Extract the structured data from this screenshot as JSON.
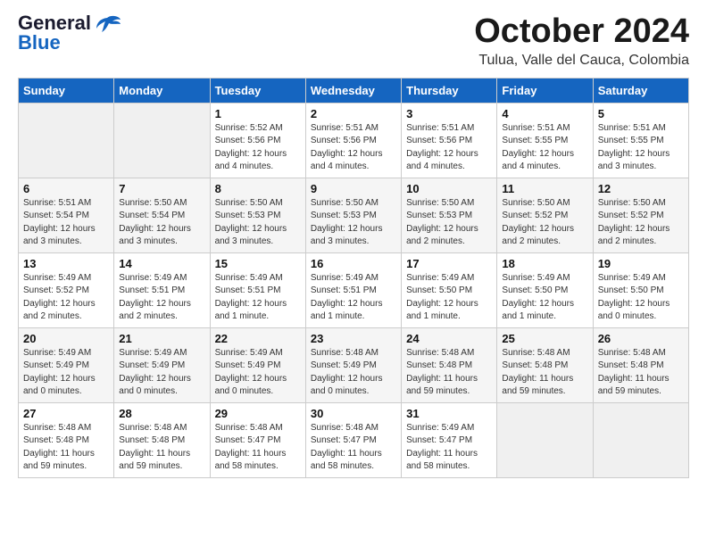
{
  "header": {
    "logo_line1": "General",
    "logo_line2": "Blue",
    "month": "October 2024",
    "location": "Tulua, Valle del Cauca, Colombia"
  },
  "weekdays": [
    "Sunday",
    "Monday",
    "Tuesday",
    "Wednesday",
    "Thursday",
    "Friday",
    "Saturday"
  ],
  "weeks": [
    [
      {
        "day": "",
        "info": ""
      },
      {
        "day": "",
        "info": ""
      },
      {
        "day": "1",
        "info": "Sunrise: 5:52 AM\nSunset: 5:56 PM\nDaylight: 12 hours\nand 4 minutes."
      },
      {
        "day": "2",
        "info": "Sunrise: 5:51 AM\nSunset: 5:56 PM\nDaylight: 12 hours\nand 4 minutes."
      },
      {
        "day": "3",
        "info": "Sunrise: 5:51 AM\nSunset: 5:56 PM\nDaylight: 12 hours\nand 4 minutes."
      },
      {
        "day": "4",
        "info": "Sunrise: 5:51 AM\nSunset: 5:55 PM\nDaylight: 12 hours\nand 4 minutes."
      },
      {
        "day": "5",
        "info": "Sunrise: 5:51 AM\nSunset: 5:55 PM\nDaylight: 12 hours\nand 3 minutes."
      }
    ],
    [
      {
        "day": "6",
        "info": "Sunrise: 5:51 AM\nSunset: 5:54 PM\nDaylight: 12 hours\nand 3 minutes."
      },
      {
        "day": "7",
        "info": "Sunrise: 5:50 AM\nSunset: 5:54 PM\nDaylight: 12 hours\nand 3 minutes."
      },
      {
        "day": "8",
        "info": "Sunrise: 5:50 AM\nSunset: 5:53 PM\nDaylight: 12 hours\nand 3 minutes."
      },
      {
        "day": "9",
        "info": "Sunrise: 5:50 AM\nSunset: 5:53 PM\nDaylight: 12 hours\nand 3 minutes."
      },
      {
        "day": "10",
        "info": "Sunrise: 5:50 AM\nSunset: 5:53 PM\nDaylight: 12 hours\nand 2 minutes."
      },
      {
        "day": "11",
        "info": "Sunrise: 5:50 AM\nSunset: 5:52 PM\nDaylight: 12 hours\nand 2 minutes."
      },
      {
        "day": "12",
        "info": "Sunrise: 5:50 AM\nSunset: 5:52 PM\nDaylight: 12 hours\nand 2 minutes."
      }
    ],
    [
      {
        "day": "13",
        "info": "Sunrise: 5:49 AM\nSunset: 5:52 PM\nDaylight: 12 hours\nand 2 minutes."
      },
      {
        "day": "14",
        "info": "Sunrise: 5:49 AM\nSunset: 5:51 PM\nDaylight: 12 hours\nand 2 minutes."
      },
      {
        "day": "15",
        "info": "Sunrise: 5:49 AM\nSunset: 5:51 PM\nDaylight: 12 hours\nand 1 minute."
      },
      {
        "day": "16",
        "info": "Sunrise: 5:49 AM\nSunset: 5:51 PM\nDaylight: 12 hours\nand 1 minute."
      },
      {
        "day": "17",
        "info": "Sunrise: 5:49 AM\nSunset: 5:50 PM\nDaylight: 12 hours\nand 1 minute."
      },
      {
        "day": "18",
        "info": "Sunrise: 5:49 AM\nSunset: 5:50 PM\nDaylight: 12 hours\nand 1 minute."
      },
      {
        "day": "19",
        "info": "Sunrise: 5:49 AM\nSunset: 5:50 PM\nDaylight: 12 hours\nand 0 minutes."
      }
    ],
    [
      {
        "day": "20",
        "info": "Sunrise: 5:49 AM\nSunset: 5:49 PM\nDaylight: 12 hours\nand 0 minutes."
      },
      {
        "day": "21",
        "info": "Sunrise: 5:49 AM\nSunset: 5:49 PM\nDaylight: 12 hours\nand 0 minutes."
      },
      {
        "day": "22",
        "info": "Sunrise: 5:49 AM\nSunset: 5:49 PM\nDaylight: 12 hours\nand 0 minutes."
      },
      {
        "day": "23",
        "info": "Sunrise: 5:48 AM\nSunset: 5:49 PM\nDaylight: 12 hours\nand 0 minutes."
      },
      {
        "day": "24",
        "info": "Sunrise: 5:48 AM\nSunset: 5:48 PM\nDaylight: 11 hours\nand 59 minutes."
      },
      {
        "day": "25",
        "info": "Sunrise: 5:48 AM\nSunset: 5:48 PM\nDaylight: 11 hours\nand 59 minutes."
      },
      {
        "day": "26",
        "info": "Sunrise: 5:48 AM\nSunset: 5:48 PM\nDaylight: 11 hours\nand 59 minutes."
      }
    ],
    [
      {
        "day": "27",
        "info": "Sunrise: 5:48 AM\nSunset: 5:48 PM\nDaylight: 11 hours\nand 59 minutes."
      },
      {
        "day": "28",
        "info": "Sunrise: 5:48 AM\nSunset: 5:48 PM\nDaylight: 11 hours\nand 59 minutes."
      },
      {
        "day": "29",
        "info": "Sunrise: 5:48 AM\nSunset: 5:47 PM\nDaylight: 11 hours\nand 58 minutes."
      },
      {
        "day": "30",
        "info": "Sunrise: 5:48 AM\nSunset: 5:47 PM\nDaylight: 11 hours\nand 58 minutes."
      },
      {
        "day": "31",
        "info": "Sunrise: 5:49 AM\nSunset: 5:47 PM\nDaylight: 11 hours\nand 58 minutes."
      },
      {
        "day": "",
        "info": ""
      },
      {
        "day": "",
        "info": ""
      }
    ]
  ]
}
